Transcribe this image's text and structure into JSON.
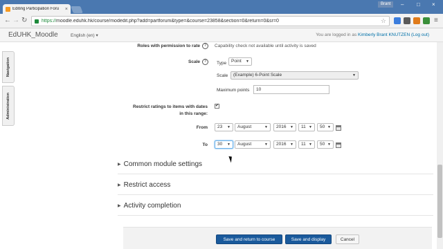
{
  "browser": {
    "tab_title": "Editing Participation Foru",
    "tab_close": "×",
    "user_badge": "Brant",
    "window_controls": [
      "–",
      "□",
      "×"
    ],
    "url_protocol": "https://",
    "url_rest": "moodle.eduhk.hk/course/modedit.php?add=partforum&type=&course=23858&section=0&return=0&sr=0",
    "nav": {
      "back": "←",
      "forward": "→",
      "reload": "↻",
      "star": "☆",
      "menu": "≡"
    }
  },
  "header": {
    "brand": "EdUHK_Moodle",
    "language": "English (en) ▾",
    "login_prefix": "You are logged in as ",
    "user_name": "Kimberly Brant KNUTZEN",
    "logout": "(Log out)"
  },
  "dock": {
    "navigation": "Navigation",
    "administration": "Administration"
  },
  "form": {
    "roles_label": "Roles with permission to rate",
    "roles_value": "Capability check not available until activity is saved",
    "scale_label": "Scale",
    "type_label": "Type",
    "type_value": "Point",
    "scale_sublabel": "Scale",
    "scale_value": "(Example) 6-Point Scale",
    "maxpoints_label": "Maximum points",
    "maxpoints_value": "10",
    "restrict_label_1": "Restrict ratings to items with dates",
    "restrict_label_2": "in this range:",
    "restrict_checked": "✔",
    "from_label": "From",
    "from": {
      "day": "23",
      "month": "August",
      "year": "2016",
      "hour": "11",
      "minute": "50"
    },
    "to_label": "To",
    "to": {
      "day": "30",
      "month": "August",
      "year": "2016",
      "hour": "11",
      "minute": "50"
    },
    "help_glyph": "?"
  },
  "sections": [
    {
      "title": "Common module settings",
      "toggle": "▶"
    },
    {
      "title": "Restrict access",
      "toggle": "▶"
    },
    {
      "title": "Activity completion",
      "toggle": "▶"
    }
  ],
  "buttons": {
    "save_return": "Save and return to course",
    "save_display": "Save and display",
    "cancel": "Cancel"
  },
  "colors": {
    "titlebar": "#4a78b0",
    "primary_button": "#1a5a9c",
    "link": "#0070a8",
    "secure": "#1e8a3c"
  }
}
